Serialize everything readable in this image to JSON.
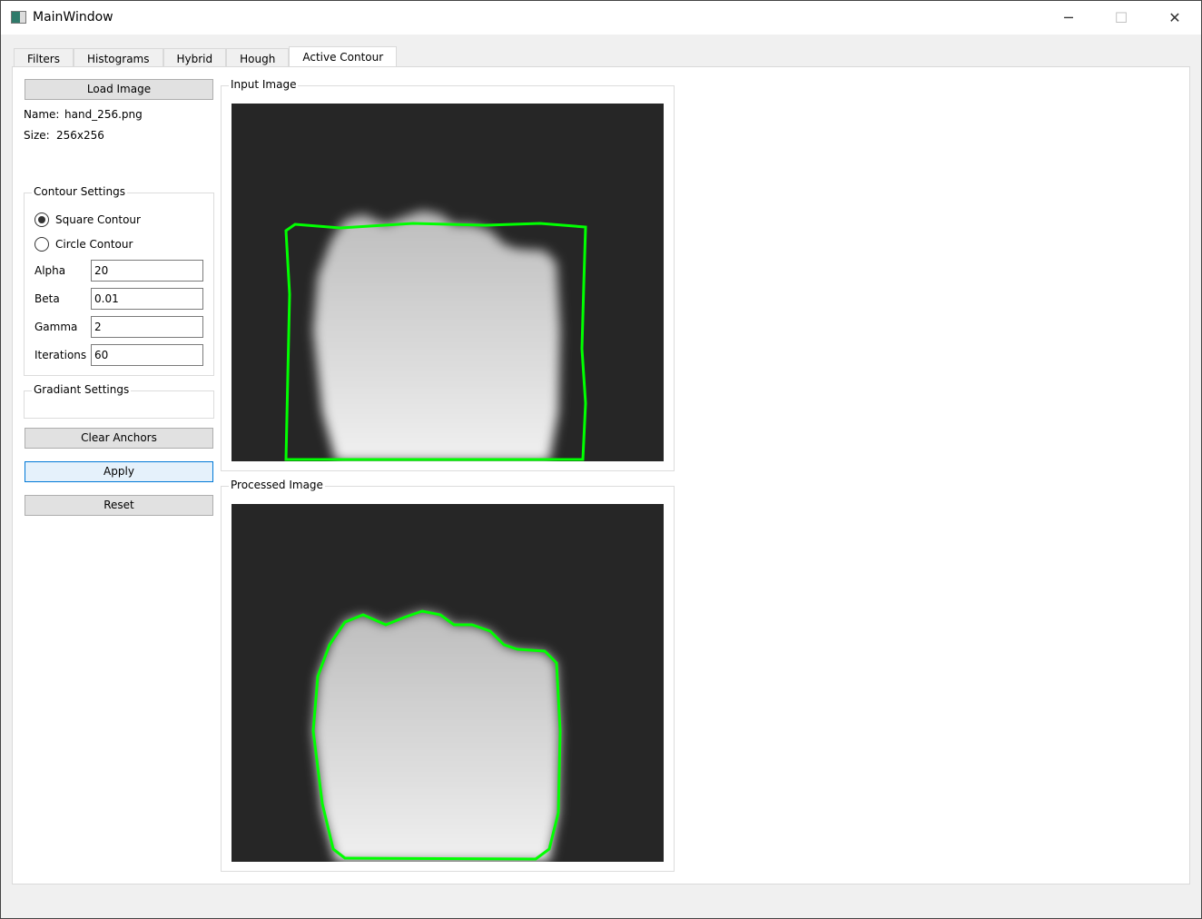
{
  "window": {
    "title": "MainWindow",
    "minimize": "─",
    "maximize": "☐",
    "close": "✕"
  },
  "tabs": [
    {
      "label": "Filters"
    },
    {
      "label": "Histograms"
    },
    {
      "label": "Hybrid"
    },
    {
      "label": "Hough"
    },
    {
      "label": "Active Contour",
      "active": true
    }
  ],
  "left": {
    "load_button": "Load Image",
    "name_label": "Name:",
    "name_value": "hand_256.png",
    "size_label": "Size:",
    "size_value": "256x256",
    "contour_settings": {
      "title": "Contour Settings",
      "options": [
        {
          "label": "Square Contour",
          "checked": true
        },
        {
          "label": "Circle Contour",
          "checked": false
        }
      ],
      "alpha_label": "Alpha",
      "alpha": "20",
      "beta_label": "Beta",
      "beta": "0.01",
      "gamma_label": "Gamma",
      "gamma": "2",
      "iterations_label": "Iterations",
      "iterations": "60"
    },
    "gradient_settings": {
      "title": "Gradiant Settings"
    },
    "clear_button": "Clear Anchors",
    "apply_button": "Apply",
    "reset_button": "Reset"
  },
  "images": {
    "input_title": "Input Image",
    "processed_title": "Processed Image",
    "contour_color": "#00ff00"
  }
}
